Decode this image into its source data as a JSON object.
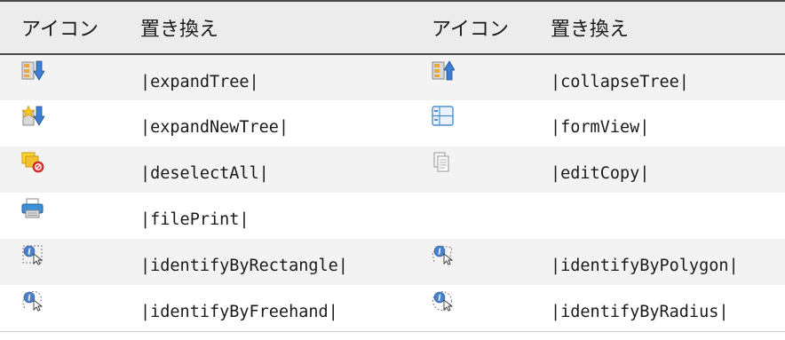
{
  "table": {
    "headers": [
      "アイコン",
      "置き換え",
      "アイコン",
      "置き換え"
    ],
    "rows": [
      {
        "left": {
          "icon": "expand-tree-icon",
          "substitution": "|expandTree|"
        },
        "right": {
          "icon": "collapse-tree-icon",
          "substitution": "|collapseTree|"
        }
      },
      {
        "left": {
          "icon": "expand-new-tree-icon",
          "substitution": "|expandNewTree|"
        },
        "right": {
          "icon": "form-view-icon",
          "substitution": "|formView|"
        }
      },
      {
        "left": {
          "icon": "deselect-all-icon",
          "substitution": "|deselectAll|"
        },
        "right": {
          "icon": "edit-copy-icon",
          "substitution": "|editCopy|"
        }
      },
      {
        "left": {
          "icon": "file-print-icon",
          "substitution": "|filePrint|"
        },
        "right": {
          "icon": "",
          "substitution": ""
        }
      },
      {
        "left": {
          "icon": "identify-by-rectangle-icon",
          "substitution": "|identifyByRectangle|"
        },
        "right": {
          "icon": "identify-by-polygon-icon",
          "substitution": "|identifyByPolygon|"
        }
      },
      {
        "left": {
          "icon": "identify-by-freehand-icon",
          "substitution": "|identifyByFreehand|"
        },
        "right": {
          "icon": "identify-by-radius-icon",
          "substitution": "|identifyByRadius|"
        }
      }
    ]
  },
  "colors": {
    "header_bg": "#ececec",
    "row_alt_bg": "#f3f3f3",
    "rule": "#4a4a4a"
  }
}
